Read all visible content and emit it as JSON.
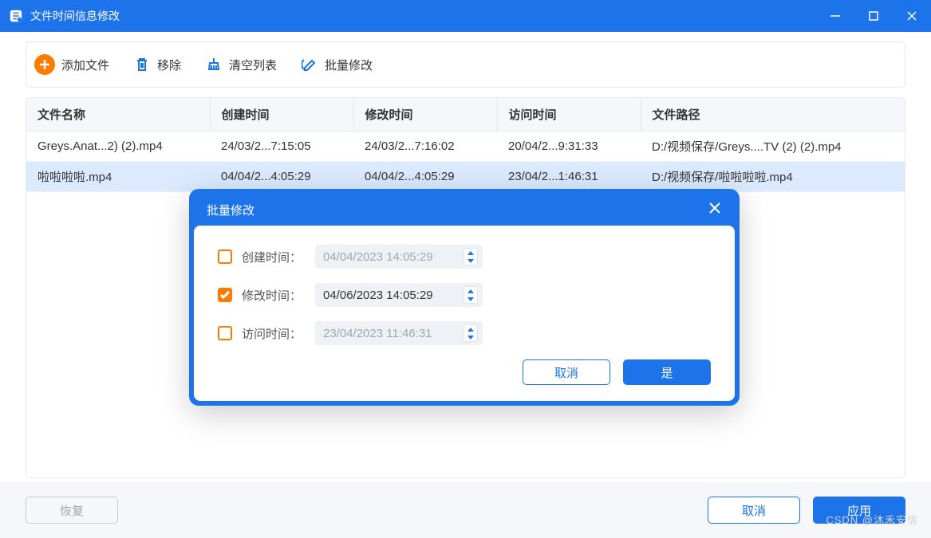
{
  "titlebar": {
    "title": "文件时间信息修改"
  },
  "toolbar": {
    "add": "添加文件",
    "remove": "移除",
    "clear": "清空列表",
    "batch": "批量修改"
  },
  "table": {
    "headers": {
      "name": "文件名称",
      "ctime": "创建时间",
      "mtime": "修改时间",
      "atime": "访问时间",
      "path": "文件路径"
    },
    "rows": [
      {
        "name": "Greys.Anat...2) (2).mp4",
        "ctime": "24/03/2...7:15:05",
        "mtime": "24/03/2...7:16:02",
        "atime": "20/04/2...9:31:33",
        "path": "D:/视频保存/Greys....TV (2) (2).mp4",
        "selected": false
      },
      {
        "name": "啦啦啦啦.mp4",
        "ctime": "04/04/2...4:05:29",
        "mtime": "04/04/2...4:05:29",
        "atime": "23/04/2...1:46:31",
        "path": "D:/视频保存/啦啦啦啦.mp4",
        "selected": true
      }
    ]
  },
  "footer": {
    "restore": "恢复",
    "cancel": "取消",
    "apply": "应用"
  },
  "modal": {
    "title": "批量修改",
    "fields": {
      "ctime": {
        "label": "创建时间：",
        "value": "04/04/2023 14:05:29",
        "checked": false
      },
      "mtime": {
        "label": "修改时间：",
        "value": "04/06/2023 14:05:29",
        "checked": true
      },
      "atime": {
        "label": "访问时间：",
        "value": "23/04/2023 11:46:31",
        "checked": false
      }
    },
    "cancel": "取消",
    "ok": "是"
  },
  "watermark": "CSDN @沐禾安信"
}
